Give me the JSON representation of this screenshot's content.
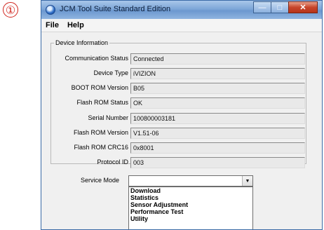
{
  "annotation": {
    "step_number": "①"
  },
  "window": {
    "title": "JCM Tool Suite Standard Edition",
    "controls": {
      "minimize": "—",
      "maximize": "□",
      "close": "✕"
    }
  },
  "menubar": {
    "items": [
      "File",
      "Help"
    ]
  },
  "device_info": {
    "legend": "Device Information",
    "fields": [
      {
        "label": "Communication Status",
        "value": "Connected"
      },
      {
        "label": "Device Type",
        "value": "iVIZION"
      },
      {
        "label": "BOOT ROM Version",
        "value": "B05"
      },
      {
        "label": "Flash ROM Status",
        "value": "OK"
      },
      {
        "label": "Serial Number",
        "value": "100800003181"
      },
      {
        "label": "Flash ROM Version",
        "value": "V1.51-06"
      },
      {
        "label": "Flash ROM CRC16",
        "value": "0x8001"
      },
      {
        "label": "Protocol ID",
        "value": "003"
      }
    ]
  },
  "service_mode": {
    "label": "Service Mode",
    "selected": "",
    "arrow": "▼",
    "options": [
      "Download",
      "Statistics",
      "Sensor Adjustment",
      "Performance Test",
      "Utility"
    ]
  }
}
